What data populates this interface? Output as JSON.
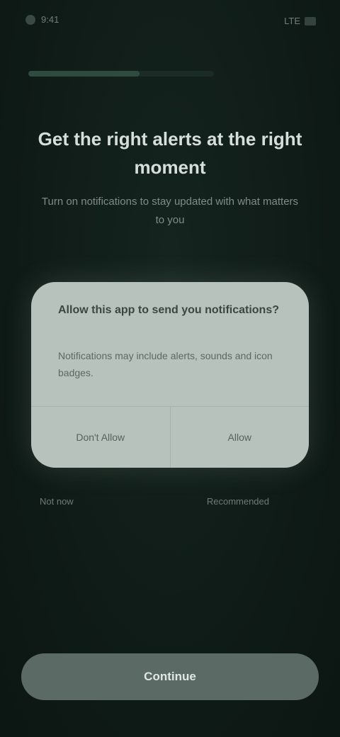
{
  "status_bar": {
    "time": "9:41",
    "right_label": "LTE"
  },
  "progress": {
    "value": 0.6
  },
  "header": {
    "title": "Get the right alerts at the right moment",
    "subtitle": "Turn on notifications to stay updated with what matters to you"
  },
  "dialog": {
    "title": "Allow this app to send you notifications?",
    "body": "Notifications may include alerts, sounds and icon badges.",
    "deny_label": "Don't Allow",
    "allow_label": "Allow"
  },
  "hints": {
    "left": "Not now",
    "right": "Recommended"
  },
  "cta": {
    "label": "Continue"
  },
  "colors": {
    "background": "#0f1b17",
    "dialog": "#b7c2bd",
    "cta": "#5b6a64"
  }
}
